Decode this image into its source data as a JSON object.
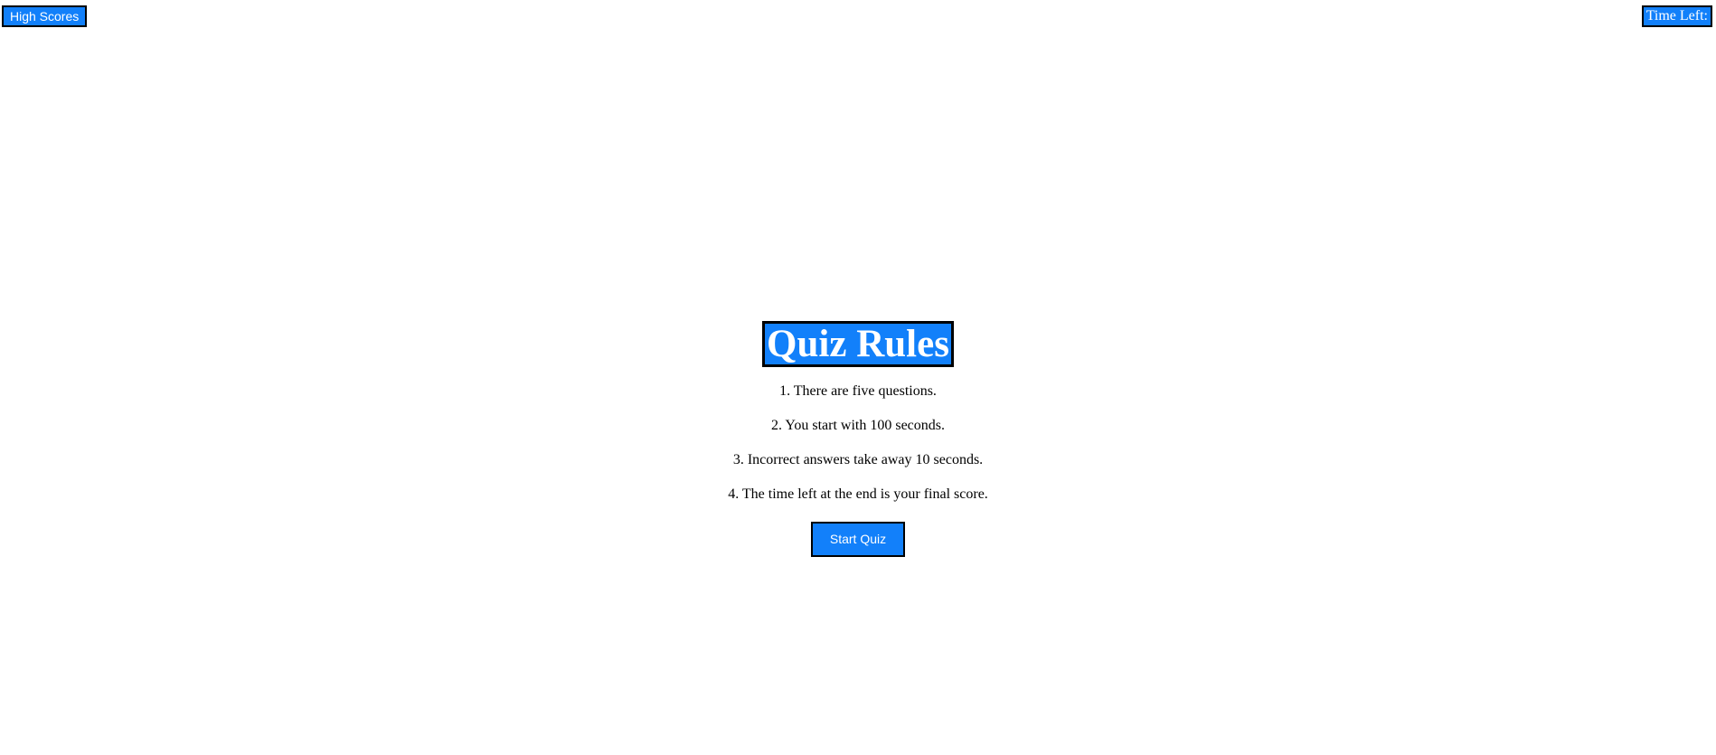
{
  "header": {
    "high_scores_label": "High Scores",
    "time_left_label": "Time Left:"
  },
  "rules": {
    "title": "Quiz Rules",
    "items": [
      "1. There are five questions.",
      "2. You start with 100 seconds.",
      "3. Incorrect answers take away 10 seconds.",
      "4. The time left at the end is your final score."
    ],
    "start_label": "Start Quiz"
  },
  "colors": {
    "accent": "#1280fa",
    "border": "#000000",
    "background": "#ffffff"
  }
}
